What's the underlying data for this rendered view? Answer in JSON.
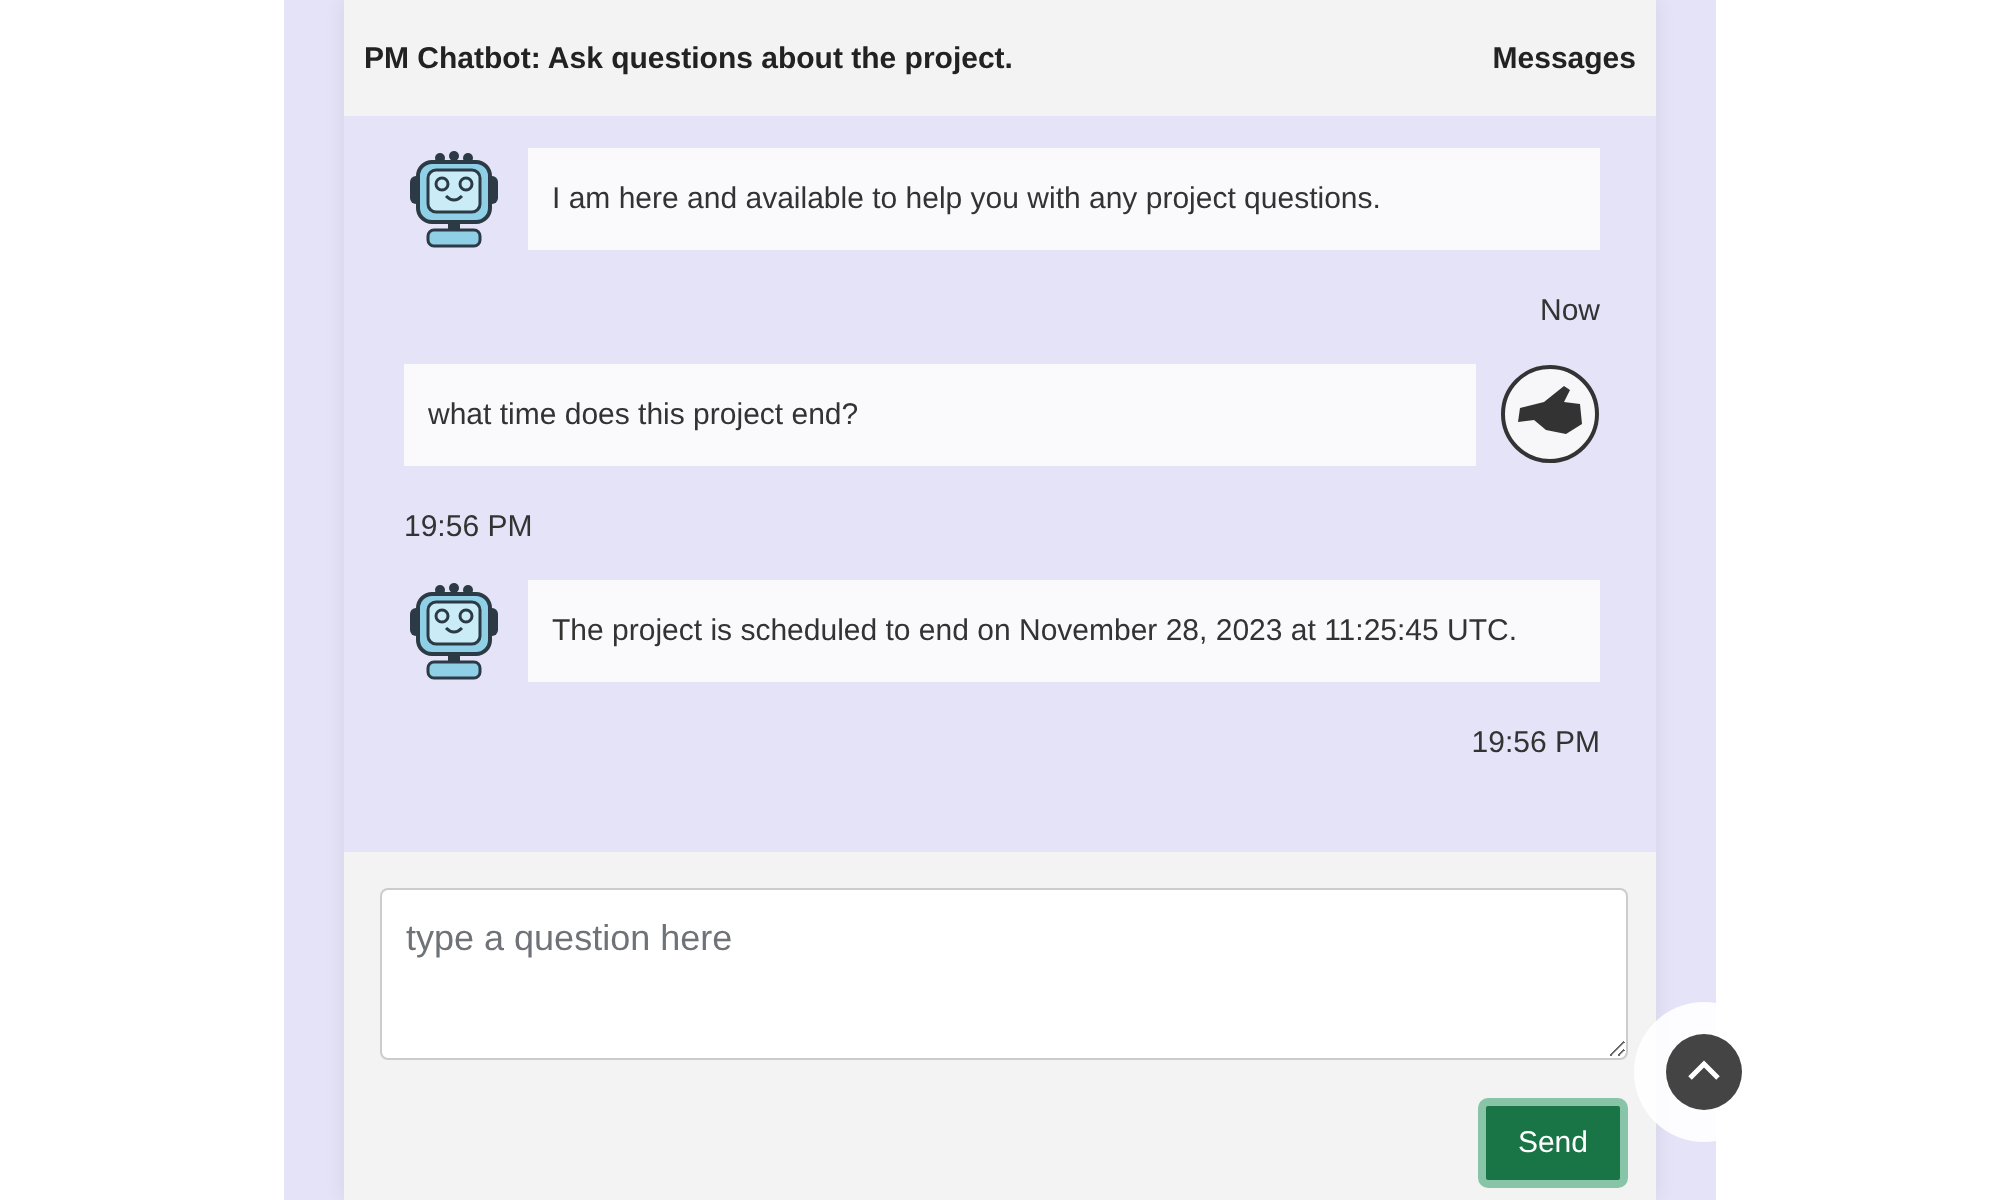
{
  "header": {
    "title": "PM Chatbot: Ask questions about the project.",
    "link": "Messages"
  },
  "messages": [
    {
      "kind": "bot",
      "text": "I am here and available to help you with any project questions.",
      "time": "Now"
    },
    {
      "kind": "user",
      "text": "what time does this project end?",
      "time": "19:56 PM"
    },
    {
      "kind": "bot",
      "text": "The project is scheduled to end on November 28, 2023 at 11:25:45 UTC.",
      "time": "19:56 PM"
    }
  ],
  "composer": {
    "placeholder": "type a question here",
    "button": "Send"
  }
}
